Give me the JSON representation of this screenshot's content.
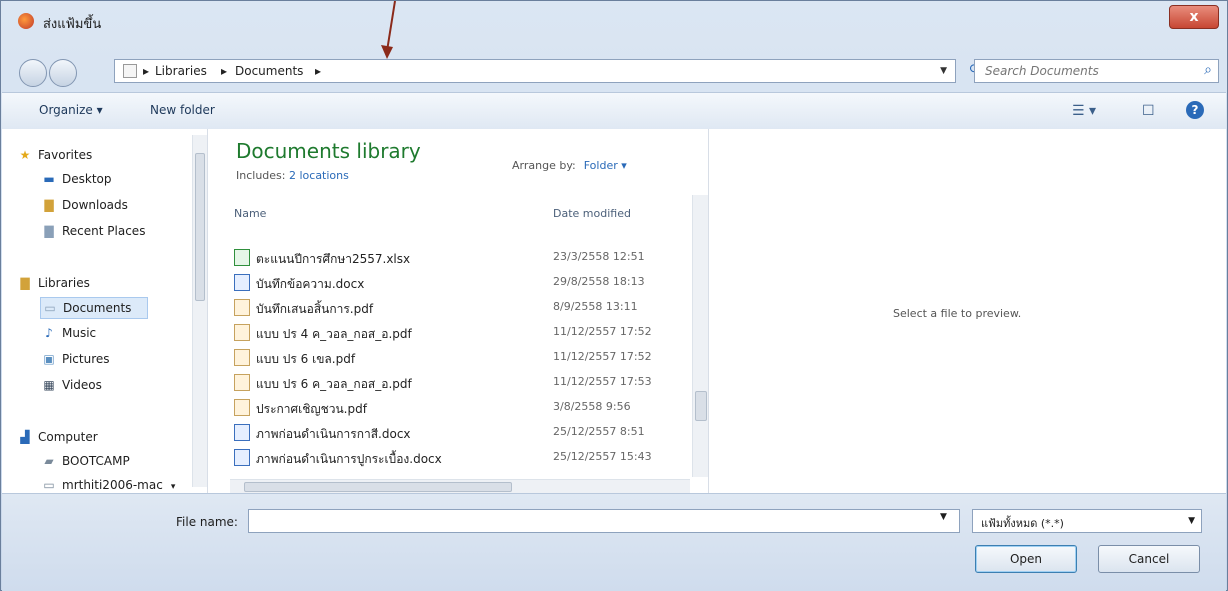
{
  "window": {
    "title": "ส่งแฟ้มขึ้น",
    "close_label": "x"
  },
  "nav": {
    "breadcrumbs": [
      "Libraries",
      "Documents"
    ],
    "search_placeholder": "Search Documents"
  },
  "toolbar": {
    "organize_label": "Organize ▾",
    "new_folder_label": "New folder"
  },
  "sidebar": {
    "favorites_label": "Favorites",
    "favorites": [
      "Desktop",
      "Downloads",
      "Recent Places"
    ],
    "libraries_label": "Libraries",
    "libraries": [
      "Documents",
      "Music",
      "Pictures",
      "Videos"
    ],
    "computer_label": "Computer",
    "computer": [
      "BOOTCAMP",
      "mrthiti2006-mac"
    ]
  },
  "library": {
    "title": "Documents library",
    "includes_prefix": "Includes:",
    "includes_link": "2 locations",
    "arrange_label": "Arrange by:",
    "arrange_value": "Folder ▾",
    "col_name": "Name",
    "col_date": "Date modified",
    "files": [
      {
        "name": "ตะแนนปีการศึกษา2557.xlsx",
        "date": "23/3/2558 12:51",
        "type": "xls"
      },
      {
        "name": "บันทึกข้อความ.docx",
        "date": "29/8/2558 18:13",
        "type": "doc"
      },
      {
        "name": "บันทึกเสนอสิ้นการ.pdf",
        "date": "8/9/2558 13:11",
        "type": "pdf"
      },
      {
        "name": "แบบ ปร 4 ค_วอล_กอส_อ.pdf",
        "date": "11/12/2557 17:52",
        "type": "pdf"
      },
      {
        "name": "แบบ ปร 6 เขล.pdf",
        "date": "11/12/2557 17:52",
        "type": "pdf"
      },
      {
        "name": "แบบ ปร 6 ค_วอล_กอส_อ.pdf",
        "date": "11/12/2557 17:53",
        "type": "pdf"
      },
      {
        "name": "ประกาศเชิญชวน.pdf",
        "date": "3/8/2558 9:56",
        "type": "pdf"
      },
      {
        "name": "ภาพก่อนดำเนินการกาสี.docx",
        "date": "25/12/2557 8:51",
        "type": "doc"
      },
      {
        "name": "ภาพก่อนดำเนินการปูกระเบื้อง.docx",
        "date": "25/12/2557 15:43",
        "type": "doc"
      }
    ]
  },
  "preview": {
    "text": "Select a file to preview."
  },
  "bottom": {
    "file_name_label": "File name:",
    "file_name_value": "",
    "filter_value": "แฟ้มทั้งหมด (*.*)",
    "open_label": "Open",
    "cancel_label": "Cancel"
  },
  "colors": {
    "library_title": "#1e7a2e",
    "link": "#2a6ab8",
    "arrow": "#8b2a1a"
  }
}
